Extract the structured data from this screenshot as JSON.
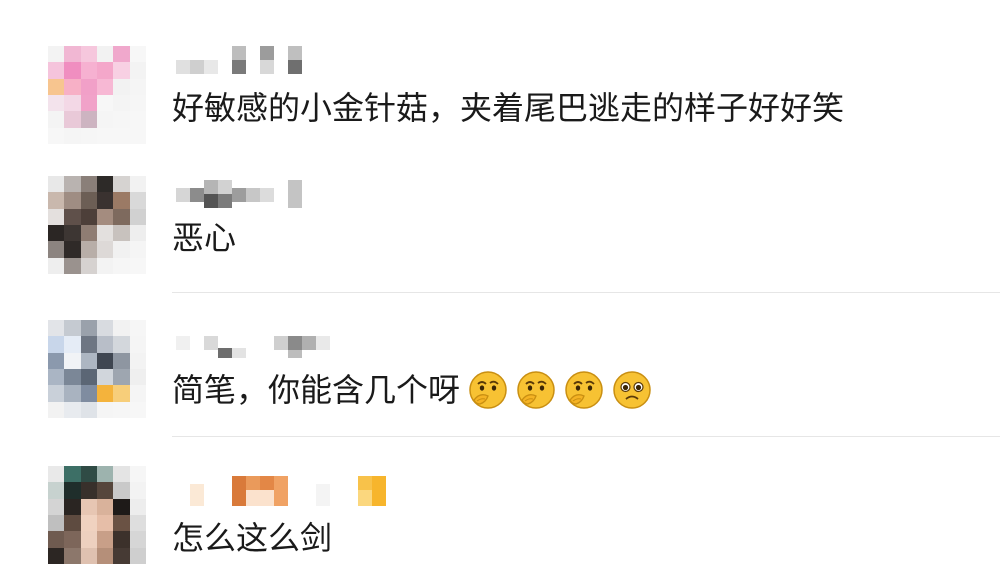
{
  "comments": [
    {
      "text": "好敏感的小金针菇，夹着尾巴逃走的样子好好笑",
      "avatar_colors": [
        "#f3f3f3",
        "#f1b7d3",
        "#f6c7dd",
        "#f2f2f2",
        "#f0a8cc",
        "#f7f7f7",
        "#f5c4dc",
        "#f08ec0",
        "#f6b1d1",
        "#f4a7ca",
        "#f8d0e3",
        "#f3f3f3",
        "#f7c58f",
        "#f7b0c6",
        "#f1a0c8",
        "#f7b8d4",
        "#f2f2f2",
        "#f5f5f5",
        "#f3e3ec",
        "#f3d8e6",
        "#f1a2c9",
        "#f7f7f7",
        "#f4f4f4",
        "#f6f6f6",
        "#f4f4f4",
        "#e9c9d8",
        "#cdb4c1",
        "#f5f5f5",
        "#f6f6f6",
        "#f7f7f7",
        "#f7f7f7",
        "#f5f5f5",
        "#f6f6f6",
        "#f7f7f7",
        "#f7f7f7",
        "#f7f7f7"
      ],
      "emojis": []
    },
    {
      "text": "恶心",
      "avatar_colors": [
        "#e8e8e8",
        "#b9b3b0",
        "#8a7f79",
        "#2d2a28",
        "#d6d3d1",
        "#f2f2f2",
        "#c9b8ad",
        "#9f8d83",
        "#6c5e55",
        "#3a3230",
        "#9b7a65",
        "#d9d9d9",
        "#e4e0de",
        "#5f504a",
        "#4d3f39",
        "#a48c7f",
        "#7e6a5e",
        "#d1d1d1",
        "#2b2624",
        "#3d3633",
        "#8f7d73",
        "#e3e0de",
        "#c8c2be",
        "#eeeeee",
        "#8c8480",
        "#2f2a28",
        "#b8aea8",
        "#ddd9d7",
        "#f1f1f1",
        "#f5f5f5",
        "#eeeeee",
        "#9a928e",
        "#d6d2d0",
        "#f3f3f3",
        "#f6f6f6",
        "#f7f7f7"
      ],
      "emojis": []
    },
    {
      "text": "简笔，你能含几个呀",
      "avatar_colors": [
        "#e2e4e8",
        "#c5cad1",
        "#9aa1ab",
        "#d8dbe0",
        "#f2f2f2",
        "#f6f6f6",
        "#c8d6ea",
        "#e5ecf6",
        "#6e7683",
        "#b8bec8",
        "#d3d7dc",
        "#f5f5f5",
        "#8b99ad",
        "#f1f3f6",
        "#adb6c2",
        "#3f4651",
        "#8e96a1",
        "#f3f3f3",
        "#aab5c4",
        "#7b8797",
        "#5b6675",
        "#d1d6dc",
        "#9ea6b0",
        "#efefef",
        "#c9d0d9",
        "#a9b3c0",
        "#7f8ca0",
        "#f4b33c",
        "#f7ce7a",
        "#f5f5f5",
        "#f2f2f2",
        "#e8ebef",
        "#dfe3e8",
        "#f5f5f5",
        "#f6f6f6",
        "#f7f7f7"
      ],
      "emojis": [
        "thinking-emoji",
        "thinking-emoji",
        "thinking-emoji",
        "pleading-emoji"
      ]
    },
    {
      "text": "怎么这么剑",
      "avatar_colors": [
        "#e9e9e9",
        "#3d6f66",
        "#2f4b45",
        "#9db3ae",
        "#e4e4e4",
        "#f6f6f6",
        "#c7d2cf",
        "#1f2e2b",
        "#38302b",
        "#56463c",
        "#c9c9c9",
        "#f3f3f3",
        "#d4d4d4",
        "#2a2522",
        "#e7c6b3",
        "#d9b29b",
        "#1e1a18",
        "#ededed",
        "#bfbfbf",
        "#5e4b40",
        "#f0d2c0",
        "#e6bea8",
        "#6a5244",
        "#dedede",
        "#6f5b50",
        "#7d665a",
        "#edd0bf",
        "#c89f88",
        "#3c312b",
        "#d6d6d6",
        "#2c2623",
        "#8c776b",
        "#dfc1b0",
        "#b58f79",
        "#463a34",
        "#cfcfcf"
      ],
      "emojis": []
    }
  ],
  "palette": {
    "text": "#1a1a1a",
    "divider": "#e6e6e6",
    "emoji_face": "#f7c233",
    "emoji_outline": "#c98f12"
  }
}
